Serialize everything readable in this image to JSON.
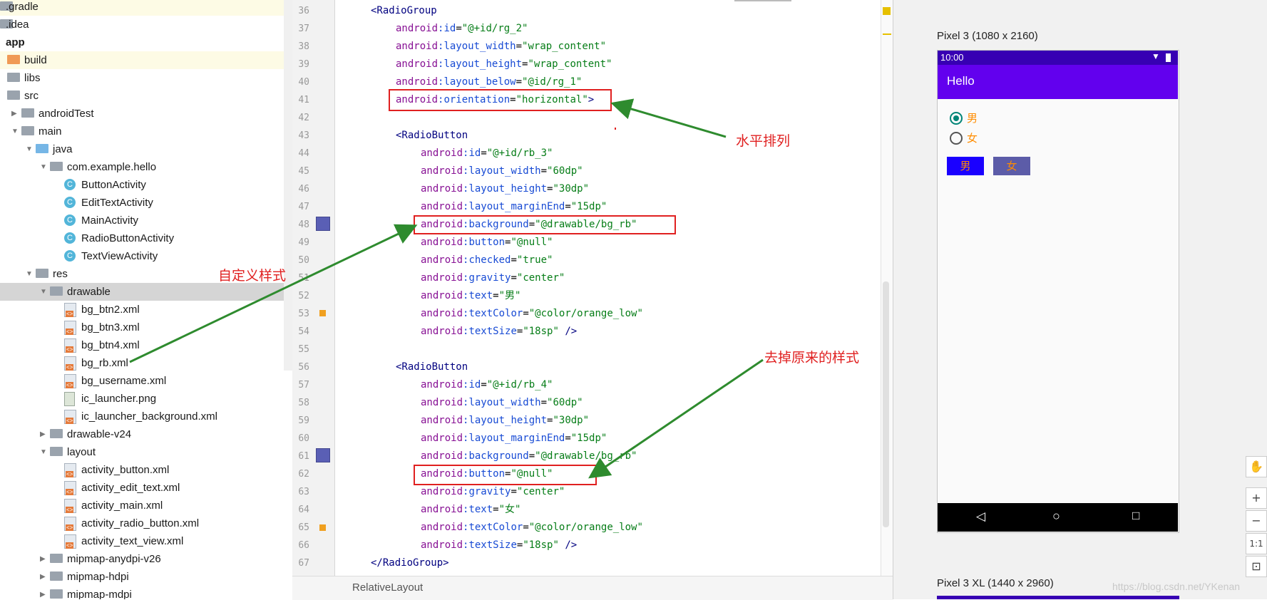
{
  "project_tree": {
    "items": [
      {
        "label": ".gradle",
        "icon": "folder-icon",
        "depth": 0,
        "arrow": ""
      },
      {
        "label": ".idea",
        "icon": "folder-icon",
        "depth": 0,
        "arrow": ""
      },
      {
        "label": "app",
        "icon": "module-icon",
        "depth": 0,
        "arrow": "",
        "bold": true
      },
      {
        "label": "build",
        "icon": "folder-icon",
        "depth": 1,
        "arrow": "",
        "color": "orange"
      },
      {
        "label": "libs",
        "icon": "folder-icon",
        "depth": 1,
        "arrow": ""
      },
      {
        "label": "src",
        "icon": "folder-icon",
        "depth": 1,
        "arrow": ""
      },
      {
        "label": "androidTest",
        "icon": "folder-icon",
        "depth": 2,
        "arrow": "▶"
      },
      {
        "label": "main",
        "icon": "folder-icon",
        "depth": 2,
        "arrow": "▼"
      },
      {
        "label": "java",
        "icon": "folder-icon",
        "depth": 3,
        "arrow": "▼",
        "color": "blue"
      },
      {
        "label": "com.example.hello",
        "icon": "package-icon",
        "depth": 4,
        "arrow": "▼"
      },
      {
        "label": "ButtonActivity",
        "icon": "class-icon",
        "depth": 5,
        "arrow": ""
      },
      {
        "label": "EditTextActivity",
        "icon": "class-icon",
        "depth": 5,
        "arrow": ""
      },
      {
        "label": "MainActivity",
        "icon": "class-icon",
        "depth": 5,
        "arrow": ""
      },
      {
        "label": "RadioButtonActivity",
        "icon": "class-icon",
        "depth": 5,
        "arrow": ""
      },
      {
        "label": "TextViewActivity",
        "icon": "class-icon",
        "depth": 5,
        "arrow": ""
      },
      {
        "label": "res",
        "icon": "folder-icon",
        "depth": 3,
        "arrow": "▼"
      },
      {
        "label": "drawable",
        "icon": "folder-icon",
        "depth": 4,
        "arrow": "▼",
        "selected": true
      },
      {
        "label": "bg_btn2.xml",
        "icon": "xml-file-icon",
        "depth": 5,
        "arrow": ""
      },
      {
        "label": "bg_btn3.xml",
        "icon": "xml-file-icon",
        "depth": 5,
        "arrow": ""
      },
      {
        "label": "bg_btn4.xml",
        "icon": "xml-file-icon",
        "depth": 5,
        "arrow": ""
      },
      {
        "label": "bg_rb.xml",
        "icon": "xml-file-icon",
        "depth": 5,
        "arrow": ""
      },
      {
        "label": "bg_username.xml",
        "icon": "xml-file-icon",
        "depth": 5,
        "arrow": ""
      },
      {
        "label": "ic_launcher.png",
        "icon": "png-file-icon",
        "depth": 5,
        "arrow": ""
      },
      {
        "label": "ic_launcher_background.xml",
        "icon": "xml-file-icon",
        "depth": 5,
        "arrow": ""
      },
      {
        "label": "drawable-v24",
        "icon": "folder-icon",
        "depth": 4,
        "arrow": "▶"
      },
      {
        "label": "layout",
        "icon": "folder-icon",
        "depth": 4,
        "arrow": "▼"
      },
      {
        "label": "activity_button.xml",
        "icon": "xml-file-icon",
        "depth": 5,
        "arrow": ""
      },
      {
        "label": "activity_edit_text.xml",
        "icon": "xml-file-icon",
        "depth": 5,
        "arrow": ""
      },
      {
        "label": "activity_main.xml",
        "icon": "xml-file-icon",
        "depth": 5,
        "arrow": ""
      },
      {
        "label": "activity_radio_button.xml",
        "icon": "xml-file-icon",
        "depth": 5,
        "arrow": ""
      },
      {
        "label": "activity_text_view.xml",
        "icon": "xml-file-icon",
        "depth": 5,
        "arrow": ""
      },
      {
        "label": "mipmap-anydpi-v26",
        "icon": "folder-icon",
        "depth": 4,
        "arrow": "▶"
      },
      {
        "label": "mipmap-hdpi",
        "icon": "folder-icon",
        "depth": 4,
        "arrow": "▶"
      },
      {
        "label": "mipmap-mdpi",
        "icon": "folder-icon",
        "depth": 4,
        "arrow": "▶"
      }
    ]
  },
  "editor": {
    "lines": [
      {
        "n": "36",
        "indent": 1,
        "parts": [
          [
            "tag",
            "<RadioGroup"
          ]
        ]
      },
      {
        "n": "37",
        "indent": 2,
        "parts": [
          [
            "pfx",
            "android"
          ],
          [
            "attr",
            ":id"
          ],
          [
            "plain",
            "="
          ],
          [
            "val",
            "\"@+id/rg_2\""
          ]
        ]
      },
      {
        "n": "38",
        "indent": 2,
        "parts": [
          [
            "pfx",
            "android"
          ],
          [
            "attr",
            ":layout_width"
          ],
          [
            "plain",
            "="
          ],
          [
            "val",
            "\"wrap_content\""
          ]
        ]
      },
      {
        "n": "39",
        "indent": 2,
        "parts": [
          [
            "pfx",
            "android"
          ],
          [
            "attr",
            ":layout_height"
          ],
          [
            "plain",
            "="
          ],
          [
            "val",
            "\"wrap_content\""
          ]
        ]
      },
      {
        "n": "40",
        "indent": 2,
        "parts": [
          [
            "pfx",
            "android"
          ],
          [
            "attr",
            ":layout_below"
          ],
          [
            "plain",
            "="
          ],
          [
            "val",
            "\"@id/rg_1\""
          ]
        ]
      },
      {
        "n": "41",
        "indent": 2,
        "parts": [
          [
            "pfx",
            "android"
          ],
          [
            "attr",
            ":orientation"
          ],
          [
            "plain",
            "="
          ],
          [
            "val",
            "\"horizontal\""
          ],
          [
            "tag",
            ">"
          ]
        ]
      },
      {
        "n": "42",
        "indent": 0,
        "parts": []
      },
      {
        "n": "43",
        "indent": 2,
        "parts": [
          [
            "tag",
            "<RadioButton"
          ]
        ]
      },
      {
        "n": "44",
        "indent": 3,
        "parts": [
          [
            "pfx",
            "android"
          ],
          [
            "attr",
            ":id"
          ],
          [
            "plain",
            "="
          ],
          [
            "val",
            "\"@+id/rb_3\""
          ]
        ]
      },
      {
        "n": "45",
        "indent": 3,
        "parts": [
          [
            "pfx",
            "android"
          ],
          [
            "attr",
            ":layout_width"
          ],
          [
            "plain",
            "="
          ],
          [
            "val",
            "\"60dp\""
          ]
        ]
      },
      {
        "n": "46",
        "indent": 3,
        "parts": [
          [
            "pfx",
            "android"
          ],
          [
            "attr",
            ":layout_height"
          ],
          [
            "plain",
            "="
          ],
          [
            "val",
            "\"30dp\""
          ]
        ]
      },
      {
        "n": "47",
        "indent": 3,
        "parts": [
          [
            "pfx",
            "android"
          ],
          [
            "attr",
            ":layout_marginEnd"
          ],
          [
            "plain",
            "="
          ],
          [
            "val",
            "\"15dp\""
          ]
        ]
      },
      {
        "n": "48",
        "indent": 3,
        "parts": [
          [
            "pfx",
            "android"
          ],
          [
            "attr",
            ":background"
          ],
          [
            "plain",
            "="
          ],
          [
            "val",
            "\"@drawable/bg_rb\""
          ]
        ]
      },
      {
        "n": "49",
        "indent": 3,
        "parts": [
          [
            "pfx",
            "android"
          ],
          [
            "attr",
            ":button"
          ],
          [
            "plain",
            "="
          ],
          [
            "val",
            "\"@null\""
          ]
        ]
      },
      {
        "n": "50",
        "indent": 3,
        "parts": [
          [
            "pfx",
            "android"
          ],
          [
            "attr",
            ":checked"
          ],
          [
            "plain",
            "="
          ],
          [
            "val",
            "\"true\""
          ]
        ]
      },
      {
        "n": "51",
        "indent": 3,
        "parts": [
          [
            "pfx",
            "android"
          ],
          [
            "attr",
            ":gravity"
          ],
          [
            "plain",
            "="
          ],
          [
            "val",
            "\"center\""
          ]
        ]
      },
      {
        "n": "52",
        "indent": 3,
        "parts": [
          [
            "pfx",
            "android"
          ],
          [
            "attr",
            ":text"
          ],
          [
            "plain",
            "="
          ],
          [
            "val",
            "\"男\""
          ]
        ]
      },
      {
        "n": "53",
        "indent": 3,
        "parts": [
          [
            "pfx",
            "android"
          ],
          [
            "attr",
            ":textColor"
          ],
          [
            "plain",
            "="
          ],
          [
            "val",
            "\"@color/orange_low\""
          ]
        ]
      },
      {
        "n": "54",
        "indent": 3,
        "parts": [
          [
            "pfx",
            "android"
          ],
          [
            "attr",
            ":textSize"
          ],
          [
            "plain",
            "="
          ],
          [
            "val",
            "\"18sp\""
          ],
          [
            "tag",
            " />"
          ]
        ]
      },
      {
        "n": "55",
        "indent": 0,
        "parts": []
      },
      {
        "n": "56",
        "indent": 2,
        "parts": [
          [
            "tag",
            "<RadioButton"
          ]
        ]
      },
      {
        "n": "57",
        "indent": 3,
        "parts": [
          [
            "pfx",
            "android"
          ],
          [
            "attr",
            ":id"
          ],
          [
            "plain",
            "="
          ],
          [
            "val",
            "\"@+id/rb_4\""
          ]
        ]
      },
      {
        "n": "58",
        "indent": 3,
        "parts": [
          [
            "pfx",
            "android"
          ],
          [
            "attr",
            ":layout_width"
          ],
          [
            "plain",
            "="
          ],
          [
            "val",
            "\"60dp\""
          ]
        ]
      },
      {
        "n": "59",
        "indent": 3,
        "parts": [
          [
            "pfx",
            "android"
          ],
          [
            "attr",
            ":layout_height"
          ],
          [
            "plain",
            "="
          ],
          [
            "val",
            "\"30dp\""
          ]
        ]
      },
      {
        "n": "60",
        "indent": 3,
        "parts": [
          [
            "pfx",
            "android"
          ],
          [
            "attr",
            ":layout_marginEnd"
          ],
          [
            "plain",
            "="
          ],
          [
            "val",
            "\"15dp\""
          ]
        ]
      },
      {
        "n": "61",
        "indent": 3,
        "parts": [
          [
            "pfx",
            "android"
          ],
          [
            "attr",
            ":background"
          ],
          [
            "plain",
            "="
          ],
          [
            "val",
            "\"@drawable/bg_rb\""
          ]
        ]
      },
      {
        "n": "62",
        "indent": 3,
        "parts": [
          [
            "pfx",
            "android"
          ],
          [
            "attr",
            ":button"
          ],
          [
            "plain",
            "="
          ],
          [
            "val",
            "\"@null\""
          ]
        ]
      },
      {
        "n": "63",
        "indent": 3,
        "parts": [
          [
            "pfx",
            "android"
          ],
          [
            "attr",
            ":gravity"
          ],
          [
            "plain",
            "="
          ],
          [
            "val",
            "\"center\""
          ]
        ]
      },
      {
        "n": "64",
        "indent": 3,
        "parts": [
          [
            "pfx",
            "android"
          ],
          [
            "attr",
            ":text"
          ],
          [
            "plain",
            "="
          ],
          [
            "val",
            "\"女\""
          ]
        ]
      },
      {
        "n": "65",
        "indent": 3,
        "parts": [
          [
            "pfx",
            "android"
          ],
          [
            "attr",
            ":textColor"
          ],
          [
            "plain",
            "="
          ],
          [
            "val",
            "\"@color/orange_low\""
          ]
        ]
      },
      {
        "n": "66",
        "indent": 3,
        "parts": [
          [
            "pfx",
            "android"
          ],
          [
            "attr",
            ":textSize"
          ],
          [
            "plain",
            "="
          ],
          [
            "val",
            "\"18sp\""
          ],
          [
            "tag",
            " />"
          ]
        ]
      },
      {
        "n": "67",
        "indent": 1,
        "parts": [
          [
            "tag",
            "</RadioGroup>"
          ]
        ]
      }
    ],
    "breadcrumb": "RelativeLayout"
  },
  "preview": {
    "device_label": "Pixel 3 (1080 x 2160)",
    "device_label_2": "Pixel 3 XL (1440 x 2960)",
    "status_time": "10:00",
    "app_title": "Hello",
    "radio_options": [
      {
        "label": "男",
        "checked": true
      },
      {
        "label": "女",
        "checked": false
      }
    ],
    "button_1": "男",
    "button_2": "女",
    "nav_back": "◁",
    "nav_home": "○",
    "nav_recent": "□",
    "toolbar": {
      "pan": "✋",
      "zoom_in": "+",
      "zoom_out": "−",
      "actual_size": "1:1",
      "fit": "⊡"
    },
    "watermark": "https://blog.csdn.net/YKenan"
  },
  "annotations": {
    "note_orientation": "水平排列",
    "note_custom_style": "自定义样式",
    "note_remove_style": "去掉原来的样式"
  },
  "colors": {
    "accent_red": "#e02020",
    "arrow_green": "#2e8b2e",
    "app_bar": "#6200ee",
    "status_bar": "#3700b3",
    "button_checked_bg": "#1a00ff",
    "button_unchecked_bg": "#5c5ca8",
    "orange_text": "#ff8c00"
  }
}
